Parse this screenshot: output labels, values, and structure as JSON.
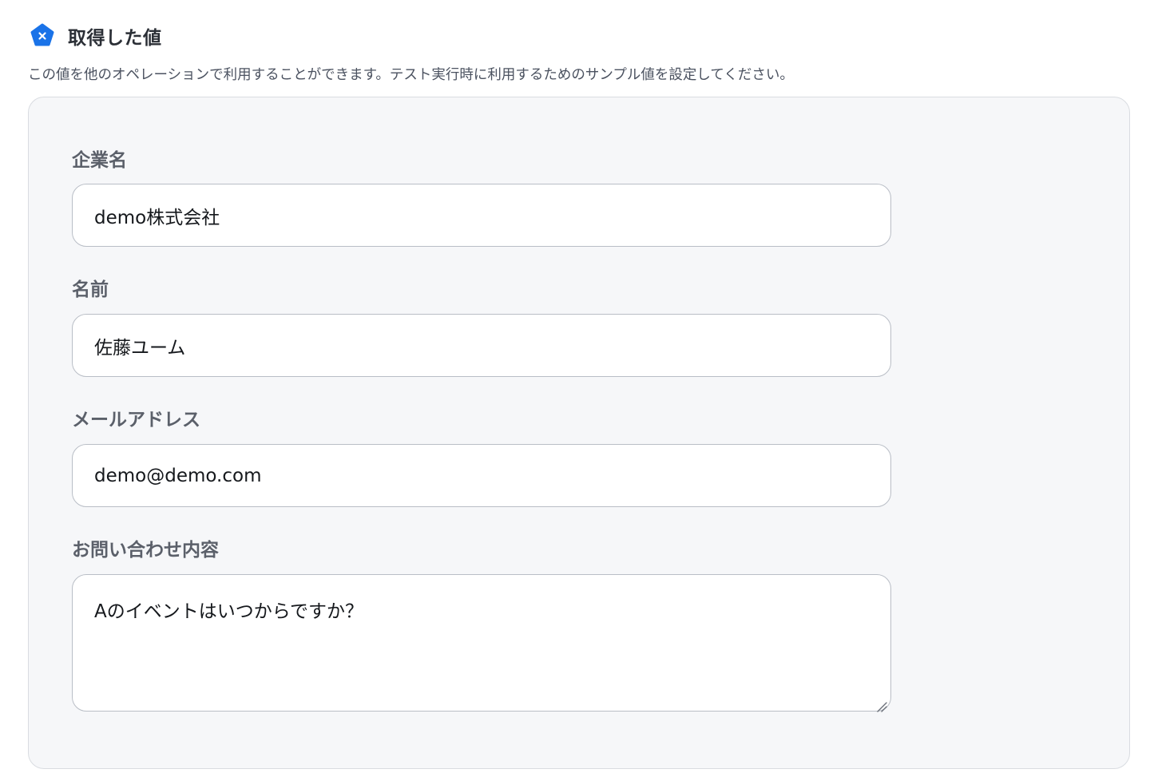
{
  "section": {
    "title": "取得した値",
    "description": "この値を他のオペレーションで利用することができます。テスト実行時に利用するためのサンプル値を設定してください。",
    "icon": "pentagon-x-icon",
    "accent_color": "#1a73e8"
  },
  "fields": [
    {
      "label": "企業名",
      "value": "demo株式会社"
    },
    {
      "label": "名前",
      "value": "佐藤ユーム"
    },
    {
      "label": "メールアドレス",
      "value": "demo@demo.com"
    },
    {
      "label": "お問い合わせ内容",
      "value": "Aのイベントはいつからですか？"
    }
  ]
}
